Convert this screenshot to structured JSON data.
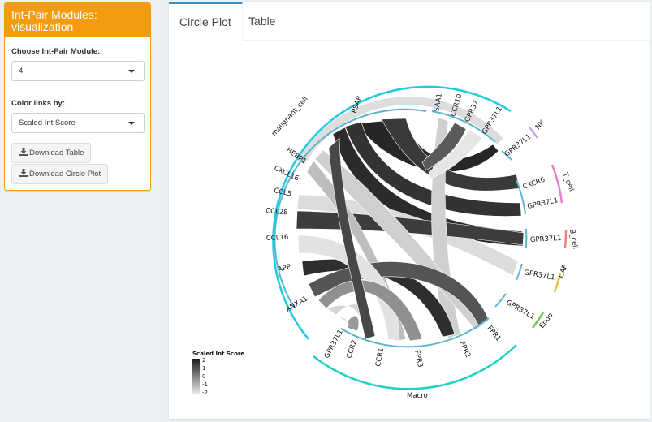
{
  "sidebar": {
    "title": "Int-Pair Modules: visualization",
    "module_label": "Choose Int-Pair Module:",
    "module_value": "4",
    "color_label": "Color links by:",
    "color_value": "Scaled Int Score",
    "download_table": "Download Table",
    "download_plot": "Download Circle Plot"
  },
  "tabs": {
    "circle": "Circle Plot",
    "table": "Table"
  },
  "plot": {
    "legend_title": "Scaled Int Score",
    "legend_ticks": [
      "2",
      "1",
      "0",
      "-1",
      "-2"
    ],
    "ligand_labels": [
      "PSAP",
      "SAA1",
      "CCR10",
      "GPR37",
      "GPR37L1",
      "HEBP1",
      "CXCL16",
      "CCL5",
      "CCL28",
      "CCL16",
      "APP",
      "ANXA1"
    ],
    "receptor_labels": [
      "GPR37L1",
      "CXCR6",
      "GPR37L1",
      "GPR37L1",
      "GPR37L1",
      "GPR37L1",
      "FPR1",
      "FPR2",
      "FPR3",
      "CCR1",
      "CCR2",
      "GPR37L1"
    ],
    "cell_types": [
      "malignant_cell",
      "NK",
      "T_cell",
      "B_cell",
      "CAF",
      "Endo",
      "Macro"
    ],
    "colors": {
      "malignant_cell": "#1ecbe1",
      "NK": "#c9a3e6",
      "T_cell": "#e87fd1",
      "B_cell": "#f08080",
      "CAF": "#e6c13c",
      "Endo": "#6cc655",
      "Macro": "#1fd1c0",
      "inner_ring": "#5ab6d0"
    }
  }
}
